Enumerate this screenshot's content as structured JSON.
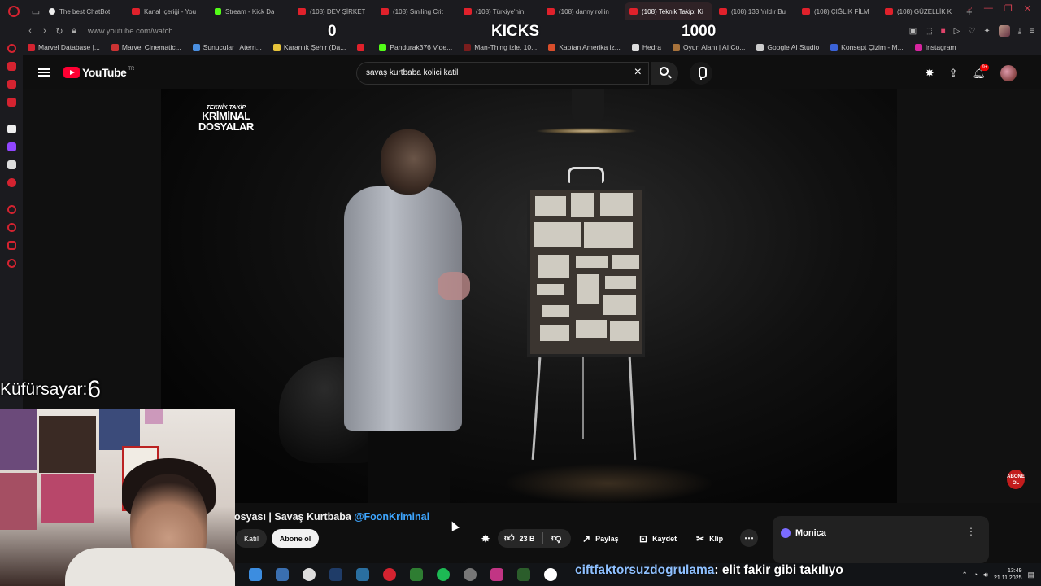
{
  "browser": {
    "tabs": [
      {
        "label": "The best ChatBot",
        "fav": "gray"
      },
      {
        "label": "Kanal içeriği - You",
        "fav": "yt"
      },
      {
        "label": "Stream - Kick Da",
        "fav": "green"
      },
      {
        "label": "(108) DEV ŞİRKET",
        "fav": "yt"
      },
      {
        "label": "(108) Smiling Crit",
        "fav": "yt"
      },
      {
        "label": "(108) Türkiye'nin",
        "fav": "yt"
      },
      {
        "label": "(108) danny rollin",
        "fav": "yt"
      },
      {
        "label": "(108) Teknik Takip: Ki",
        "fav": "yt",
        "active": true
      },
      {
        "label": "(108) 133 Yıldır Bu",
        "fav": "yt"
      },
      {
        "label": "(108) ÇIĞLIK FİLM",
        "fav": "yt"
      },
      {
        "label": "(108) GÜZELLİK K",
        "fav": "yt"
      }
    ],
    "url": "www.youtube.com/watch",
    "bookmarks": [
      {
        "label": "Marvel Database |...",
        "color": "#d42330"
      },
      {
        "label": "Marvel Cinematic...",
        "color": "#c33"
      },
      {
        "label": "Sunucular | Atern...",
        "color": "#4a8fe0"
      },
      {
        "label": "Karanlık Şehir (Da...",
        "color": "#e6c33a"
      },
      {
        "label": "",
        "color": "#e0212b"
      },
      {
        "label": "Pandurak376 Vide...",
        "color": "#53fc18"
      },
      {
        "label": "Man-Thing izle, 10...",
        "color": "#7a1d1d"
      },
      {
        "label": "Kaptan Amerika iz...",
        "color": "#d94e2b"
      },
      {
        "label": "Hedra",
        "color": "#ddd"
      },
      {
        "label": "Oyun Alanı | AI Co...",
        "color": "#a7723b"
      },
      {
        "label": "Google AI Studio",
        "color": "#ccc"
      },
      {
        "label": "Konsept Çizim - M...",
        "color": "#3b63d8"
      },
      {
        "label": "Instagram",
        "color": "#d6249f"
      }
    ]
  },
  "overlay": {
    "counter_left": "0",
    "counter_title": "KICKS",
    "counter_right": "1000",
    "swear_label": "Küfürsayar:",
    "swear_count": "6",
    "ticker_user": "ciftfaktorsuzdogrulama",
    "ticker_text": ": elit fakir gibi takılıyo"
  },
  "youtube": {
    "logo": "YouTube",
    "country": "TR",
    "search_value": "savaş kurtbaba kolici katil",
    "notifications": "9+",
    "watermark": {
      "line1": "TEKNİK TAKİP",
      "line2": "KRİMİNAL",
      "line3": "DOSYALAR"
    },
    "subscribe_badge": "ABONE OL",
    "video_title": "osyası | Savaş Kurtbaba ",
    "video_handle": "@FoonKriminal",
    "join_label": "Katıl",
    "subscribe_label": "Abone ol",
    "likes": "23 B",
    "share_label": "Paylaş",
    "save_label": "Kaydet",
    "clip_label": "Klip"
  },
  "monica": {
    "title": "Monica"
  },
  "taskbar": {
    "time": "13:49",
    "date": "21.11.2025"
  }
}
